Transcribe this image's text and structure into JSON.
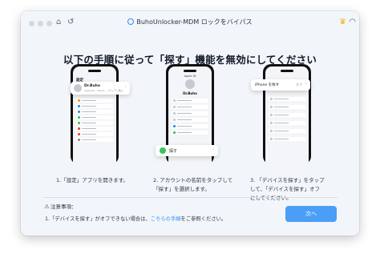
{
  "app": {
    "title": "BuhoUnlocker-MDM ロックをバイパス"
  },
  "heading": "以下の手順に従って「探す」機能を無効にしてください",
  "phone1": {
    "header": "設定",
    "account_name": "Dr.Buho",
    "account_sub": "Apple ID、iCloud、メディアと購入",
    "rows": [
      {
        "color": "#ff9500"
      },
      {
        "color": "#2f8df5"
      },
      {
        "color": "#2f8df5"
      },
      {
        "color": "#34c759"
      },
      {
        "color": "#34c759"
      },
      {
        "color": "#ff3b30"
      },
      {
        "color": "#ff3b30"
      },
      {
        "color": "#8e8e93"
      }
    ]
  },
  "phone2": {
    "header": "Apple ID",
    "account_name": "Dr.Buho",
    "find_label": "探す"
  },
  "phone3": {
    "popup_label": "iPhone を探す",
    "popup_state": "オフ"
  },
  "steps": [
    {
      "lines": [
        "1.「設定」アプリを開きます。"
      ]
    },
    {
      "lines": [
        "2. アカウントの名前をタップして",
        "「探す」を選択します。"
      ]
    },
    {
      "lines": [
        "3. 「デバイスを探す」をタップ",
        "して、「デバイスを探す」オフ",
        "にしてください。"
      ]
    }
  ],
  "note": {
    "title": "注意事項：",
    "text_before": "1.「デバイスを探す」がオフできない場合は、",
    "link": "こちらの手順",
    "text_after": "をご参照ください。"
  },
  "buttons": {
    "next": "次へ"
  },
  "colors": {
    "accent": "#4a9ef6",
    "crown": "#f1b21a",
    "find_green": "#34c759"
  }
}
